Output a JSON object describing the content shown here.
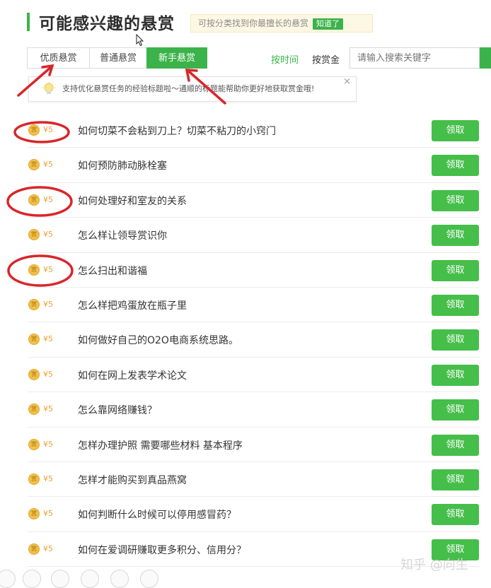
{
  "header": {
    "title": "可能感兴趣的悬赏",
    "hint_text": "可按分类找到你最擅长的悬赏",
    "hint_button": "知道了"
  },
  "tabs": [
    {
      "label": "优质悬赏",
      "active": false
    },
    {
      "label": "普通悬赏",
      "active": false
    },
    {
      "label": "新手悬赏",
      "active": true
    }
  ],
  "sort": {
    "by_time": "按时间",
    "by_bounty": "按赏金"
  },
  "search": {
    "placeholder": "请输入搜索关键字"
  },
  "tip": {
    "text": "支持优化悬赏任务的经验标题啦～通顺的标题能帮助你更好地获取赏金哦!",
    "close": "×"
  },
  "coin_glyph": "赏",
  "questions": [
    {
      "amount": "¥5",
      "text": "如何切菜不会粘到刀上？切菜不粘刀的小窍门",
      "action": "领取"
    },
    {
      "amount": "¥5",
      "text": "如何预防肺动脉栓塞",
      "action": "领取"
    },
    {
      "amount": "¥5",
      "text": "如何处理好和室友的关系",
      "action": "领取"
    },
    {
      "amount": "¥5",
      "text": "怎么样让领导赏识你",
      "action": "领取"
    },
    {
      "amount": "¥5",
      "text": "怎么扫出和谐福",
      "action": "领取"
    },
    {
      "amount": "¥5",
      "text": "怎么样把鸡蛋放在瓶子里",
      "action": "领取"
    },
    {
      "amount": "¥5",
      "text": "如何做好自己的O2O电商系统思路。",
      "action": "领取"
    },
    {
      "amount": "¥5",
      "text": "如何在网上发表学术论文",
      "action": "领取"
    },
    {
      "amount": "¥5",
      "text": "怎么靠网络赚钱？",
      "action": "领取"
    },
    {
      "amount": "¥5",
      "text": "怎样办理护照 需要哪些材料 基本程序",
      "action": "领取"
    },
    {
      "amount": "¥5",
      "text": "怎样才能购买到真品燕窝",
      "action": "领取"
    },
    {
      "amount": "¥5",
      "text": "如何判断什么时候可以停用感冒药？",
      "action": "领取"
    },
    {
      "amount": "¥5",
      "text": "如何在爱调研赚取更多积分、信用分？",
      "action": "领取"
    }
  ],
  "watermark": "知乎 @向生",
  "colors": {
    "accent": "#3cb34a",
    "claim_button": "#46be4a",
    "annotation_red": "#d8262b",
    "coin": "#f2c04a"
  }
}
